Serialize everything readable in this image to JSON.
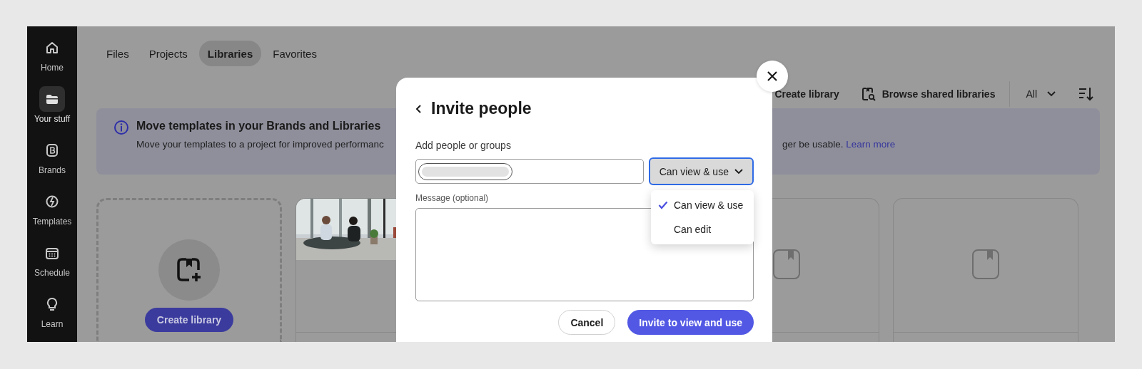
{
  "sidebar": {
    "items": [
      {
        "label": "Home",
        "selected": false
      },
      {
        "label": "Your stuff",
        "selected": true
      },
      {
        "label": "Brands",
        "selected": false
      },
      {
        "label": "Templates",
        "selected": false
      },
      {
        "label": "Schedule",
        "selected": false
      },
      {
        "label": "Learn",
        "selected": false
      }
    ]
  },
  "tabs": [
    {
      "label": "Files",
      "selected": false
    },
    {
      "label": "Projects",
      "selected": false
    },
    {
      "label": "Libraries",
      "selected": true
    },
    {
      "label": "Favorites",
      "selected": false
    }
  ],
  "toolbar": {
    "create_library": "Create library",
    "browse": "Browse shared libraries",
    "filter": "All"
  },
  "banner": {
    "title": "Move templates in your Brands and Libraries",
    "body_start": "Move your templates to a project for improved performanc",
    "body_end": "ger be usable.",
    "link": "Learn more"
  },
  "create_card": {
    "button": "Create library"
  },
  "dialog": {
    "title": "Invite people",
    "people_label": "Add people or groups",
    "permission": "Can view & use",
    "menu": [
      {
        "label": "Can view & use",
        "selected": true
      },
      {
        "label": "Can edit",
        "selected": false
      }
    ],
    "message_label": "Message (optional)",
    "cancel": "Cancel",
    "submit": "Invite to view and use"
  }
}
